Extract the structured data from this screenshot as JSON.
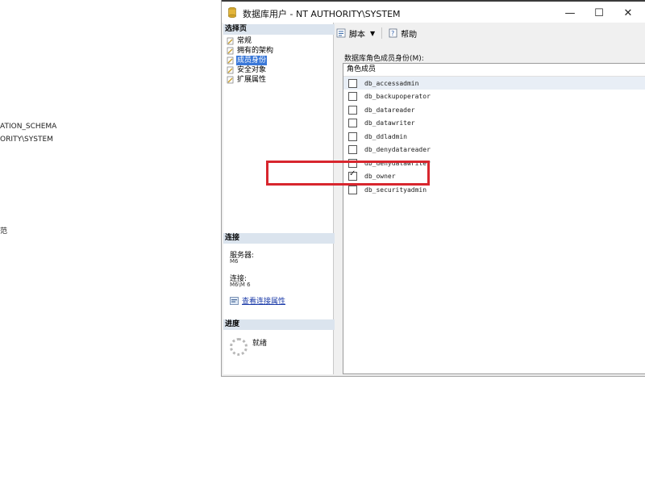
{
  "background": {
    "fragments": [
      "ATION_SCHEMA",
      "ORITY\\SYSTEM",
      "范"
    ]
  },
  "dialog": {
    "title": "数据库用户 - NT AUTHORITY\\SYSTEM",
    "controls": {
      "minimize": "—",
      "maximize": "☐",
      "close": "✕"
    }
  },
  "left_panel": {
    "select_page_header": "选择页",
    "pages": [
      {
        "label": "常规",
        "active": false
      },
      {
        "label": "拥有的架构",
        "active": false
      },
      {
        "label": "成员身份",
        "active": true
      },
      {
        "label": "安全对象",
        "active": false
      },
      {
        "label": "扩展属性",
        "active": false
      }
    ],
    "connection_header": "连接",
    "server_label": "服务器:",
    "server_value": "M6",
    "connection_label": "连接:",
    "connection_value": "M6\\M 6",
    "view_connection_link": "查看连接属性",
    "progress_header": "进度",
    "progress_status": "就绪"
  },
  "toolbar": {
    "script_label": "脚本",
    "help_label": "帮助"
  },
  "roles": {
    "label": "数据库角色成员身份(M):",
    "column_header": "角色成员",
    "items": [
      {
        "name": "db_accessadmin",
        "checked": false
      },
      {
        "name": "db_backupoperator",
        "checked": false
      },
      {
        "name": "db_datareader",
        "checked": false
      },
      {
        "name": "db_datawriter",
        "checked": false
      },
      {
        "name": "db_ddladmin",
        "checked": false
      },
      {
        "name": "db_denydatareader",
        "checked": false
      },
      {
        "name": "db_denydatawriter",
        "checked": false
      },
      {
        "name": "db_owner",
        "checked": true
      },
      {
        "name": "db_securityadmin",
        "checked": false
      }
    ]
  },
  "colors": {
    "accent": "#3a78d8",
    "highlight": "#d8262e",
    "section_header": "#dbe4ee"
  }
}
